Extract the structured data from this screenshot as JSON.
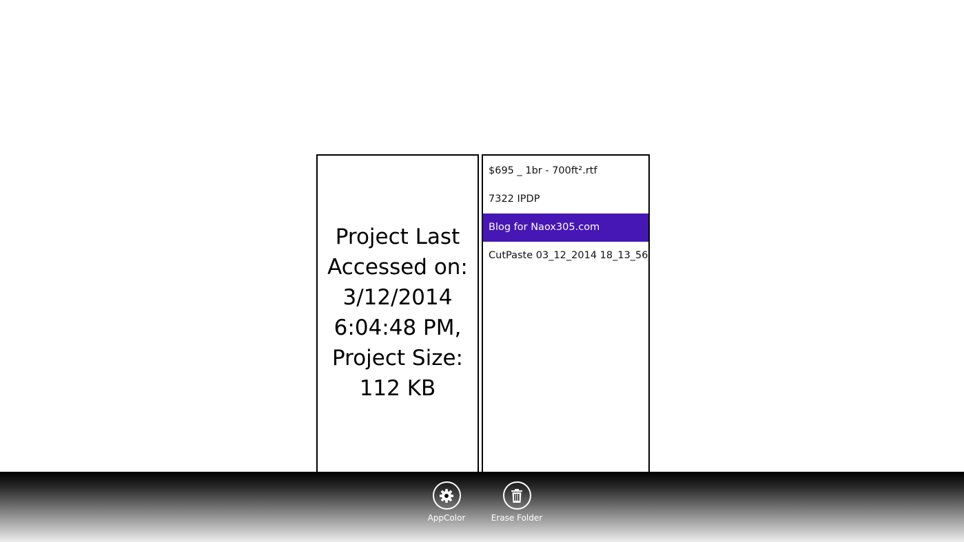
{
  "colors": {
    "accent": "#4617B4",
    "appbar_top": "#000000",
    "appbar_bottom": "#EDEDED"
  },
  "info_panel": {
    "text": "Project Last Accessed on: 3/12/2014 6:04:48 PM, Project Size: 112 KB"
  },
  "project_list": {
    "selected_index": 2,
    "items": [
      {
        "label": "$695 _ 1br - 700ft².rtf"
      },
      {
        "label": "7322 IPDP"
      },
      {
        "label": "Blog for Naox305.com"
      },
      {
        "label": "CutPaste 03_12_2014 18_13_56"
      }
    ]
  },
  "app_bar": {
    "buttons": [
      {
        "label": "AppColor",
        "icon": "gear-icon"
      },
      {
        "label": "Erase Folder",
        "icon": "trash-icon"
      }
    ]
  }
}
